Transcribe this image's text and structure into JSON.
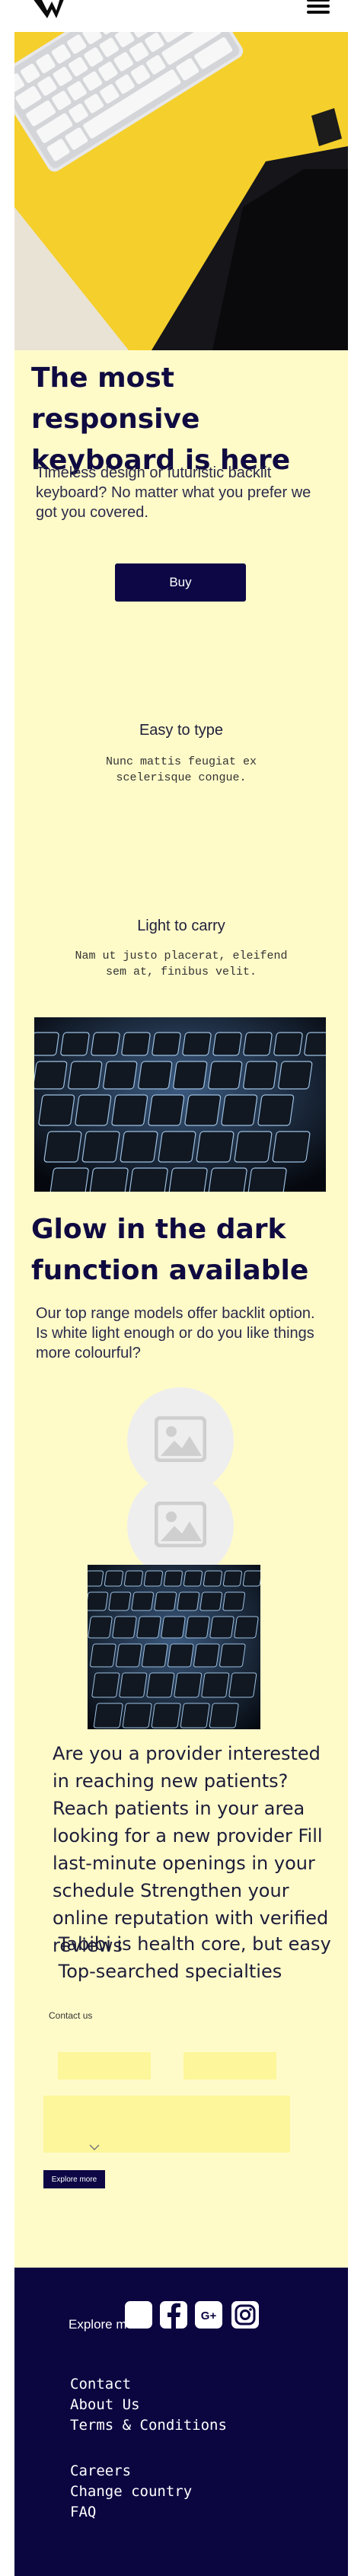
{
  "header": {
    "logo_icon": "brand-w-logo-icon",
    "menu_icon": "hamburger-menu-icon"
  },
  "hero": {
    "image": "keyboard-on-yellow-desk-photo",
    "title": "The most responsive keyboard is here",
    "lead": "Timeless design or futuristic backlit keyboard? No matter what you prefer we got you covered.",
    "cta_label": "Buy"
  },
  "features": [
    {
      "title": "Easy to type",
      "text": "Nunc mattis feugiat ex scelerisque congue."
    },
    {
      "title": "Light to carry",
      "text": "Nam ut justo placerat, eleifend sem at, finibus velit."
    }
  ],
  "backlit": {
    "image": "backlit-keyboard-photo",
    "title": "Glow in the dark function available",
    "lead": "Our top range models offer backlit option. Is white light enough or do you like things more colourful?",
    "placeholders": [
      "image-placeholder-icon",
      "image-placeholder-icon"
    ],
    "image_small": "backlit-keyboard-closeup-photo"
  },
  "provider": {
    "lines": [
      "Are you a provider interested in reaching new patients?",
      "Reach patients in your area looking for a new provider Fill last-minute openings in your schedule Strengthen your online reputation with verified reviews",
      " Tabibi is health core, but easy",
      " Top-searched specialties"
    ]
  },
  "contact": {
    "label": "Contact us",
    "field1_value": "",
    "field2_value": "",
    "message_value": "",
    "button_label": "Explore more"
  },
  "footer": {
    "explore_label": "Explore more",
    "social": [
      "square-icon",
      "facebook-icon",
      "google-plus-icon",
      "instagram-icon"
    ],
    "google_plus_label": "G+",
    "links_primary": [
      "Contact",
      "About Us",
      "Terms & Conditions"
    ],
    "links_secondary": [
      "Careers",
      "Change country",
      "FAQ"
    ]
  },
  "colors": {
    "panel_bg": "#fffbc9",
    "navy": "#0d0745",
    "input_yellow": "#fdf69a",
    "footer_bg": "#0b0540"
  }
}
